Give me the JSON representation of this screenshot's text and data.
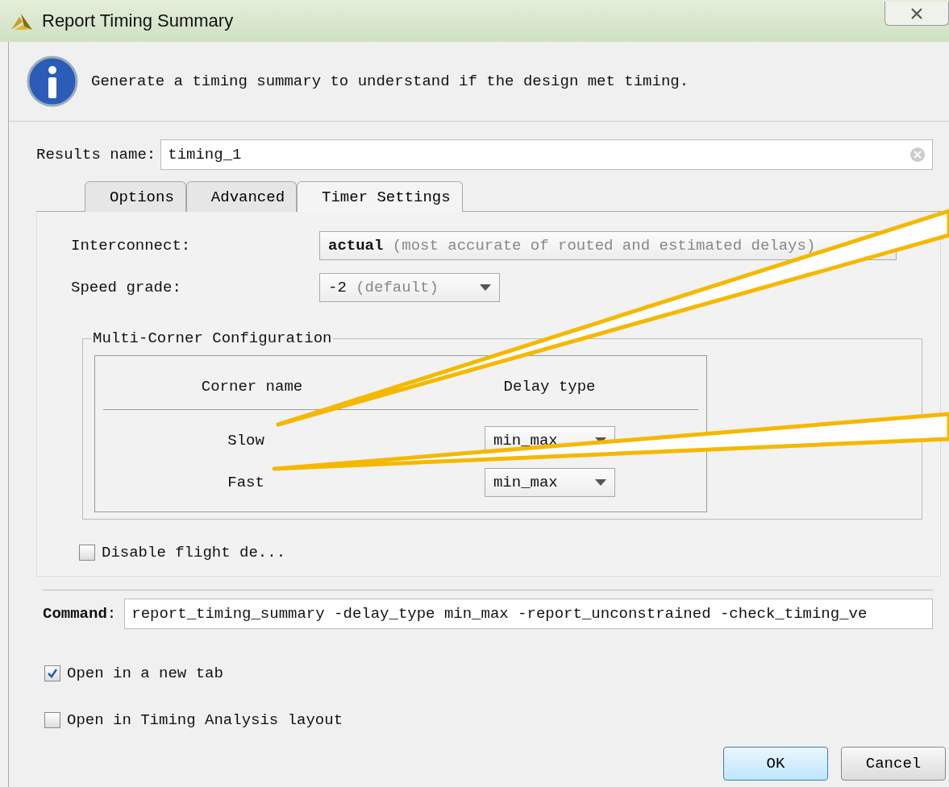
{
  "window": {
    "title": "Report Timing Summary"
  },
  "info": "Generate a timing summary to understand if the design met timing.",
  "results_name": {
    "label": "Results name:",
    "value": "timing_1"
  },
  "tabs": [
    {
      "label": "Options",
      "selected": false
    },
    {
      "label": "Advanced",
      "selected": false
    },
    {
      "label": "Timer Settings",
      "selected": true
    }
  ],
  "interconnect": {
    "label": "Interconnect:",
    "value": "actual",
    "hint": "(most accurate of routed and estimated delays)"
  },
  "speed_grade": {
    "label": "Speed grade:",
    "value": "-2",
    "hint": "(default)"
  },
  "multi_corner": {
    "title": "Multi-Corner Configuration",
    "columns": [
      "Corner name",
      "Delay type"
    ],
    "rows": [
      {
        "corner": "Slow",
        "delay_type": "min_max"
      },
      {
        "corner": "Fast",
        "delay_type": "min_max"
      }
    ]
  },
  "disable_flight": {
    "label": "Disable flight de...",
    "checked": false
  },
  "command": {
    "label": "**Command**:",
    "value": "report_timing_summary -delay_type min_max -report_unconstrained -check_timing_ve"
  },
  "options": [
    {
      "label": "Open in a new tab",
      "checked": true
    },
    {
      "label": "Open in Timing Analysis layout",
      "checked": false
    }
  ],
  "buttons": [
    {
      "label": "OK",
      "default": true
    },
    {
      "label": "Cancel",
      "default": false
    }
  ]
}
